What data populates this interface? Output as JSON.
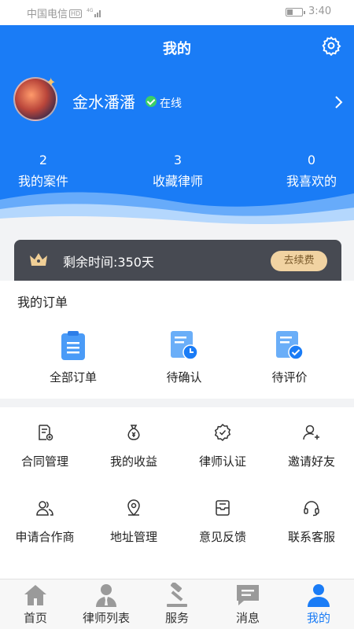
{
  "status_bar": {
    "carrier": "中国电信",
    "network_badge": "HD",
    "network_type": "4G",
    "time": "3:40"
  },
  "header": {
    "title": "我的",
    "username": "金水潘潘",
    "online_status": "在线",
    "stats": [
      {
        "value": "2",
        "label": "我的案件"
      },
      {
        "value": "3",
        "label": "收藏律师"
      },
      {
        "value": "0",
        "label": "我喜欢的"
      }
    ]
  },
  "vip": {
    "remaining": "剩余时间:350天",
    "renew_label": "去续费"
  },
  "orders": {
    "title": "我的订单",
    "items": [
      {
        "label": "全部订单",
        "icon": "clipboard-list-icon"
      },
      {
        "label": "待确认",
        "icon": "pending-clock-icon"
      },
      {
        "label": "待评价",
        "icon": "review-check-icon"
      }
    ]
  },
  "tools": {
    "items": [
      {
        "label": "合同管理",
        "icon": "contract-icon"
      },
      {
        "label": "我的收益",
        "icon": "money-bag-icon"
      },
      {
        "label": "律师认证",
        "icon": "badge-check-icon"
      },
      {
        "label": "邀请好友",
        "icon": "add-user-icon"
      },
      {
        "label": "申请合作商",
        "icon": "partner-icon"
      },
      {
        "label": "地址管理",
        "icon": "location-pin-icon"
      },
      {
        "label": "意见反馈",
        "icon": "feedback-icon"
      },
      {
        "label": "联系客服",
        "icon": "headset-icon"
      }
    ]
  },
  "tabbar": {
    "items": [
      {
        "label": "首页",
        "icon": "home-icon"
      },
      {
        "label": "律师列表",
        "icon": "lawyer-icon"
      },
      {
        "label": "服务",
        "icon": "gavel-icon"
      },
      {
        "label": "消息",
        "icon": "message-icon"
      },
      {
        "label": "我的",
        "icon": "profile-icon",
        "active": true
      }
    ]
  },
  "colors": {
    "primary": "#1a7cf6",
    "vip_bar": "#474a52",
    "renew_button": "#f1d3a2",
    "online": "#3ccf66"
  }
}
